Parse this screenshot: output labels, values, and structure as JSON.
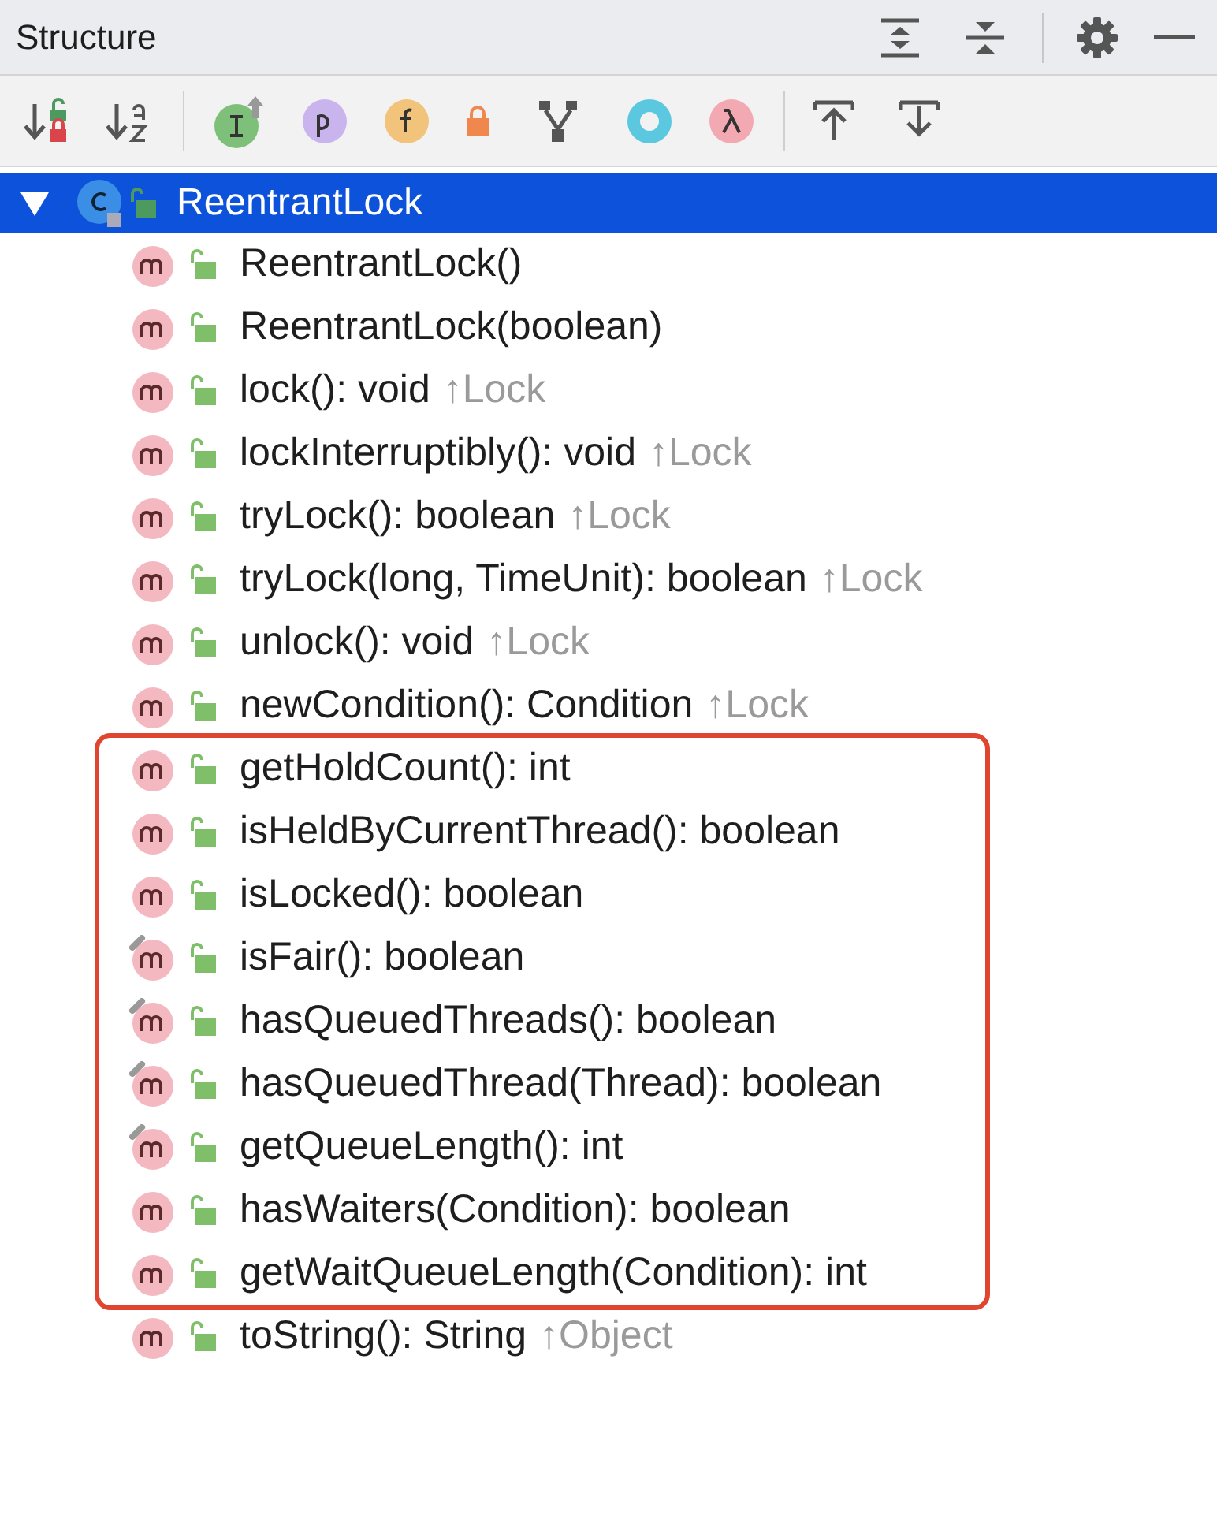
{
  "panel": {
    "title": "Structure"
  },
  "root": {
    "name": "ReentrantLock",
    "expanded": true,
    "selected": true,
    "children": [
      {
        "kind": "method",
        "signature": "ReentrantLock()",
        "final": false
      },
      {
        "kind": "method",
        "signature": "ReentrantLock(boolean)",
        "final": false
      },
      {
        "kind": "method",
        "signature": "lock(): void",
        "inherited": "↑Lock",
        "final": false
      },
      {
        "kind": "method",
        "signature": "lockInterruptibly(): void",
        "inherited": "↑Lock",
        "final": false
      },
      {
        "kind": "method",
        "signature": "tryLock(): boolean",
        "inherited": "↑Lock",
        "final": false
      },
      {
        "kind": "method",
        "signature": "tryLock(long, TimeUnit): boolean",
        "inherited": "↑Lock",
        "final": false
      },
      {
        "kind": "method",
        "signature": "unlock(): void",
        "inherited": "↑Lock",
        "final": false
      },
      {
        "kind": "method",
        "signature": "newCondition(): Condition",
        "inherited": "↑Lock",
        "final": false
      },
      {
        "kind": "highlight_frame",
        "methods": [
          {
            "signature": "getHoldCount(): int",
            "final": false
          },
          {
            "signature": "isHeldByCurrentThread(): boolean",
            "final": false
          },
          {
            "signature": "isLocked(): boolean",
            "final": false
          },
          {
            "signature": "isFair(): boolean",
            "final": true
          },
          {
            "signature": "hasQueuedThreads(): boolean",
            "final": true
          },
          {
            "signature": "hasQueuedThread(Thread): boolean",
            "final": true
          },
          {
            "signature": "getQueueLength(): int",
            "final": true
          },
          {
            "signature": "hasWaiters(Condition): boolean",
            "final": false
          },
          {
            "signature": "getWaitQueueLength(Condition): int",
            "final": false
          }
        ]
      },
      {
        "kind": "method",
        "signature": "toString(): String",
        "inherited": "↑Object",
        "final": false
      }
    ]
  }
}
